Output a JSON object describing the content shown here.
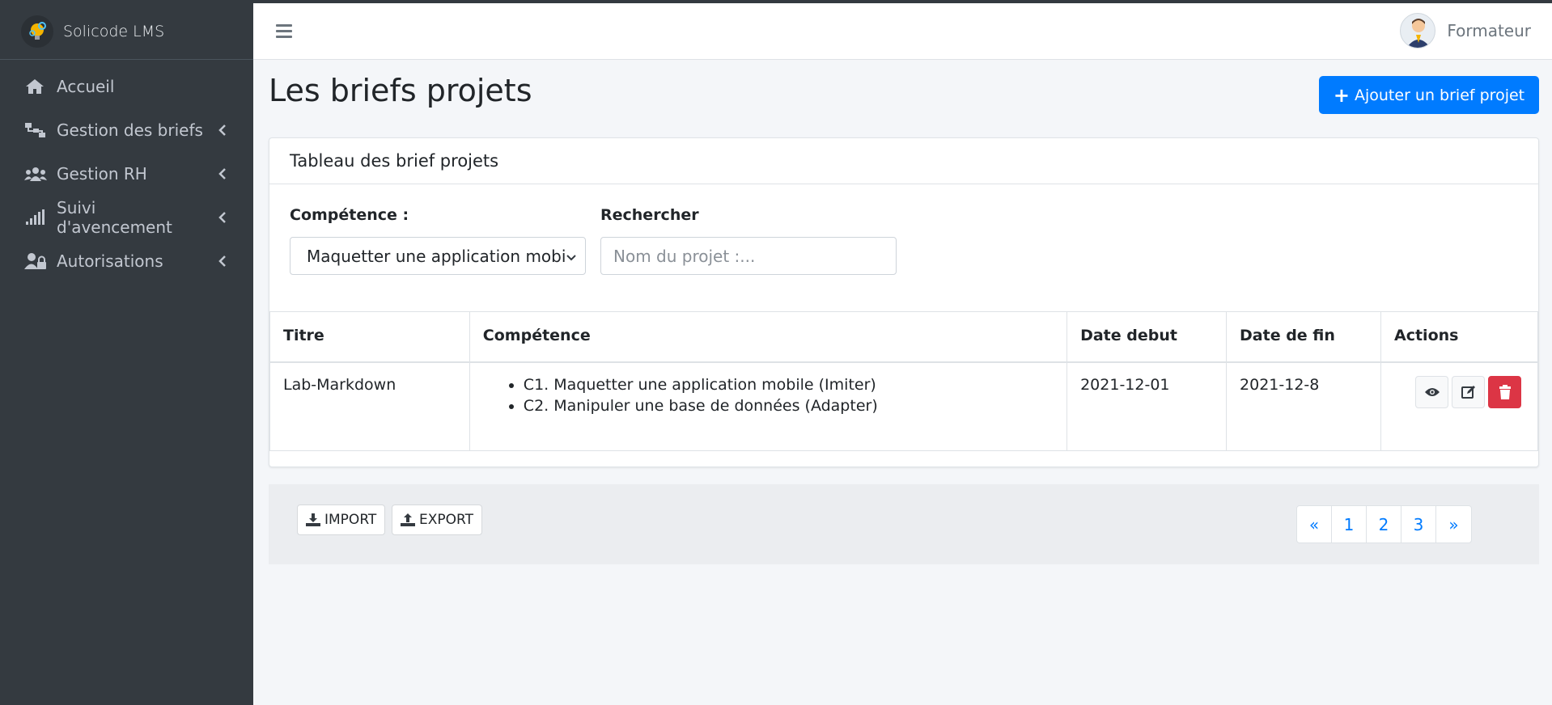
{
  "app": {
    "brand": "Solicode LMS"
  },
  "sidebar": {
    "items": [
      {
        "label": "Accueil",
        "icon": "home-icon",
        "has_submenu": false
      },
      {
        "label": "Gestion des briefs",
        "icon": "sitemap-icon",
        "has_submenu": true
      },
      {
        "label": "Gestion RH",
        "icon": "users-icon",
        "has_submenu": true
      },
      {
        "label": "Suivi d'avencement",
        "icon": "signal-icon",
        "has_submenu": true
      },
      {
        "label": "Autorisations",
        "icon": "user-lock-icon",
        "has_submenu": true
      }
    ]
  },
  "header": {
    "user_name": "Formateur"
  },
  "page": {
    "title": "Les briefs projets",
    "add_button": "Ajouter un brief projet"
  },
  "card": {
    "title": "Tableau des brief projets",
    "filter_competence_label": "Compétence :",
    "filter_competence_value": "Maquetter une application mobile",
    "search_label": "Rechercher",
    "search_placeholder": "Nom du projet :..."
  },
  "table": {
    "headers": [
      "Titre",
      "Compétence",
      "Date debut",
      "Date de fin",
      "Actions"
    ],
    "rows": [
      {
        "titre": "Lab-Markdown",
        "competences": [
          "C1. Maquetter une application mobile (Imiter)",
          "C2. Manipuler une base de données (Adapter)"
        ],
        "date_debut": "2021-12-01",
        "date_fin": "2021-12-8"
      }
    ]
  },
  "footer": {
    "import_label": "IMPORT",
    "export_label": "EXPORT",
    "pagination": [
      "«",
      "1",
      "2",
      "3",
      "»"
    ]
  },
  "colors": {
    "primary": "#007bff",
    "danger": "#dc3545",
    "sidebar": "#343a40"
  }
}
